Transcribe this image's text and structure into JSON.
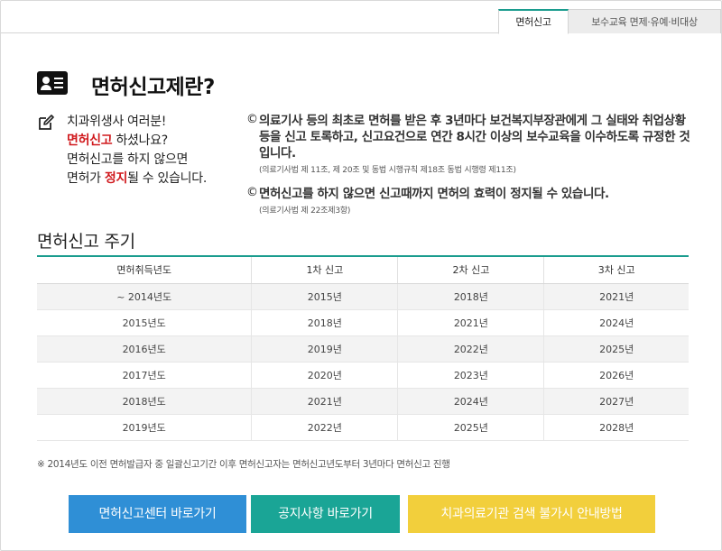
{
  "tabs": [
    {
      "label": "면허신고",
      "active": true
    },
    {
      "label": "보수교육 면제·유예·비대상",
      "active": false
    }
  ],
  "header": {
    "title": "면허신고제란?",
    "icon": "id-card-icon"
  },
  "intro": {
    "icon": "edit-icon",
    "line1": "치과위생사 여러분!",
    "line2_highlight": "면허신고",
    "line2_rest": " 하셨나요?",
    "line3": "면허신고를 하지 않으면",
    "line4_pre": "면허가 ",
    "line4_highlight": "정지",
    "line4_rest": "될 수 있습니다.",
    "highlight_color": "#d0191d"
  },
  "notes": [
    {
      "mark": "©",
      "text": "의료기사 등의 최초로 면허를 받은 후 3년마다 보건복지부장관에게 그 실태와 취업상황 등을 신고 토록하고, 신고요건으로 연간 8시간 이상의 보수교육을 이수하도록 규정한 것입니다.",
      "source": "(의료기사법 제 11조, 제 20조 및 동법 시행규칙 제18조 동법 시행령 제11조)"
    },
    {
      "mark": "©",
      "text": "면허신고를 하지 않으면 신고때까지 면허의 효력이 정지될 수 있습니다.",
      "source": "(의료기사법 제 22조제3항)"
    }
  ],
  "cycle": {
    "title": "면허신고 주기",
    "headers": [
      "면허취득년도",
      "1차 신고",
      "2차 신고",
      "3차 신고"
    ],
    "rows": [
      [
        "~ 2014년도",
        "2015년",
        "2018년",
        "2021년"
      ],
      [
        "2015년도",
        "2018년",
        "2021년",
        "2024년"
      ],
      [
        "2016년도",
        "2019년",
        "2022년",
        "2025년"
      ],
      [
        "2017년도",
        "2020년",
        "2023년",
        "2026년"
      ],
      [
        "2018년도",
        "2021년",
        "2024년",
        "2027년"
      ],
      [
        "2019년도",
        "2022년",
        "2025년",
        "2028년"
      ]
    ],
    "footnote": "※ 2014년도 이전 면허발급자 중 일괄신고기간 이후 면허신고자는 면허신고년도부터 3년마다 면허신고 진행"
  },
  "buttons": [
    {
      "label": "면허신고센터 바로가기",
      "color": "#2f8fd6"
    },
    {
      "label": "공지사항 바로가기",
      "color": "#1aa596"
    },
    {
      "label": "치과의료기관 검색 불가시 안내방법",
      "color": "#f2cf3c"
    }
  ],
  "accent_color": "#1a9c8e"
}
